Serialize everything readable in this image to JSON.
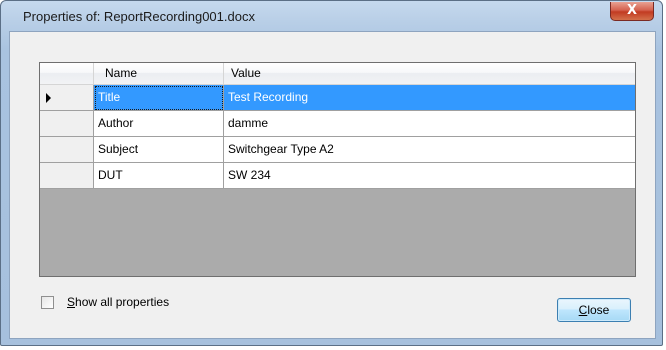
{
  "window": {
    "title": "Properties of: ReportRecording001.docx",
    "close_glyph": "X"
  },
  "grid": {
    "columns": [
      "Name",
      "Value"
    ],
    "rows": [
      {
        "name": "Title",
        "value": "Test Recording",
        "selected": true
      },
      {
        "name": "Author",
        "value": "damme",
        "selected": false
      },
      {
        "name": "Subject",
        "value": "Switchgear Type A2",
        "selected": false
      },
      {
        "name": "DUT",
        "value": "SW 234",
        "selected": false
      }
    ]
  },
  "footer": {
    "show_all_label_mnemonic": "S",
    "show_all_label_rest": "how all properties",
    "show_all_checked": false,
    "close_label_mnemonic": "C",
    "close_label_rest": "lose"
  },
  "icons": {
    "current_row": "row-pointer-icon",
    "window_close": "close-icon"
  },
  "colors": {
    "selection": "#3399ff",
    "empty_grid_area": "#ababab",
    "window_close": "#c23b22"
  }
}
